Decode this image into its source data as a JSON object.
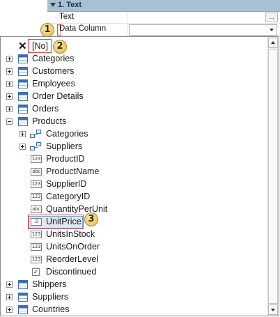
{
  "property_grid": {
    "group_title": "1. Text",
    "text_row_label": "Text",
    "text_row_button": "...",
    "data_column_label": "Data Column",
    "data_column_value": ""
  },
  "callouts": [
    "1",
    "2",
    "3"
  ],
  "tree": {
    "none_item": "[No]",
    "tables_top": [
      "Categories",
      "Customers",
      "Employees",
      "Order Details",
      "Orders"
    ],
    "products": {
      "label": "Products",
      "relations": [
        "Categories",
        "Suppliers"
      ],
      "fields": [
        {
          "label": "ProductID",
          "type": "123"
        },
        {
          "label": "ProductName",
          "type": "abc"
        },
        {
          "label": "SupplierID",
          "type": "123"
        },
        {
          "label": "CategoryID",
          "type": "123"
        },
        {
          "label": "QuantityPerUnit",
          "type": "abc"
        },
        {
          "label": "UnitPrice",
          "type": ".0"
        },
        {
          "label": "UnitsInStock",
          "type": "123"
        },
        {
          "label": "UnitsOnOrder",
          "type": "123"
        },
        {
          "label": "ReorderLevel",
          "type": "123"
        },
        {
          "label": "Discontinued",
          "type": "✓"
        }
      ],
      "selected_field": "UnitPrice"
    },
    "tables_bottom": [
      "Shippers",
      "Suppliers",
      "Countries"
    ]
  },
  "colors": {
    "group_header": "#a9bfd4",
    "callout": "#e3b94a",
    "highlight": "#e24545",
    "selection": "#dde8f4"
  }
}
